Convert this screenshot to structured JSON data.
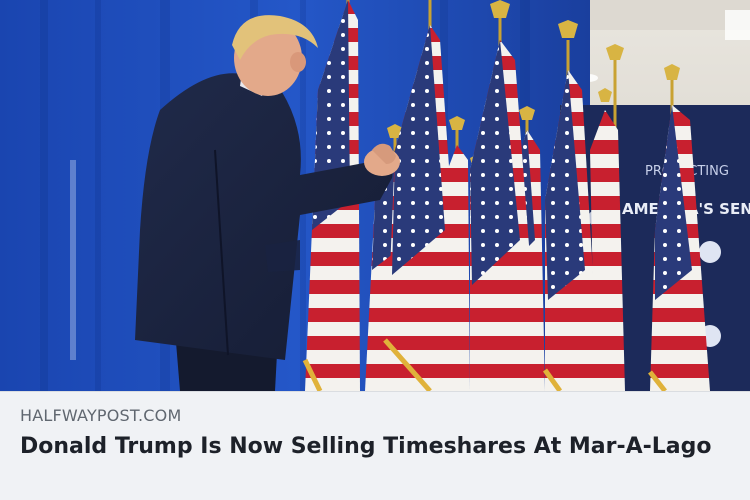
{
  "link_preview": {
    "image_alt": "Man in navy suit at a rally in front of a row of American flags and a blue curtain",
    "banner_text": [
      "PROTECTING",
      "AMERICA'S SENIORS"
    ],
    "domain": "HALFWAYPOST.COM",
    "headline": "Donald Trump Is Now Selling Timeshares At Mar-A-Lago"
  },
  "colors": {
    "curtain": "#1f4fbf",
    "caption_bg": "#f0f2f5",
    "domain_text": "#606770",
    "headline_text": "#1d2129"
  }
}
